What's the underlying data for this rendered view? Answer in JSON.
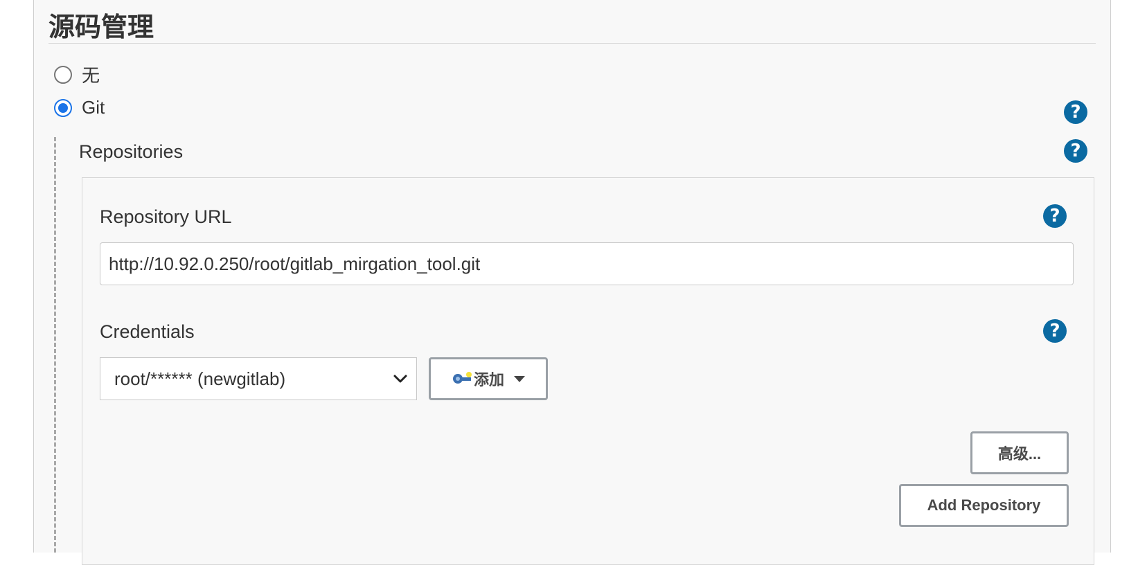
{
  "section": {
    "title": "源码管理"
  },
  "scm": {
    "options": [
      {
        "label": "无",
        "selected": false
      },
      {
        "label": "Git",
        "selected": true
      }
    ]
  },
  "repositories": {
    "heading": "Repositories",
    "url_label": "Repository URL",
    "url_value": "http://10.92.0.250/root/gitlab_mirgation_tool.git",
    "credentials_label": "Credentials",
    "credentials_selected": "root/****** (newgitlab)",
    "add_button": "添加",
    "advanced_button": "高级...",
    "add_repository_button": "Add Repository"
  },
  "icons": {
    "help": "help-icon",
    "key": "key-icon",
    "dropdown": "caret-down-icon",
    "select": "chevron-down-icon"
  },
  "colors": {
    "help_bg": "#0b6aa2",
    "radio_accent": "#1a73e8",
    "panel_bg": "#f8f8f8"
  },
  "help_glyph": "?"
}
